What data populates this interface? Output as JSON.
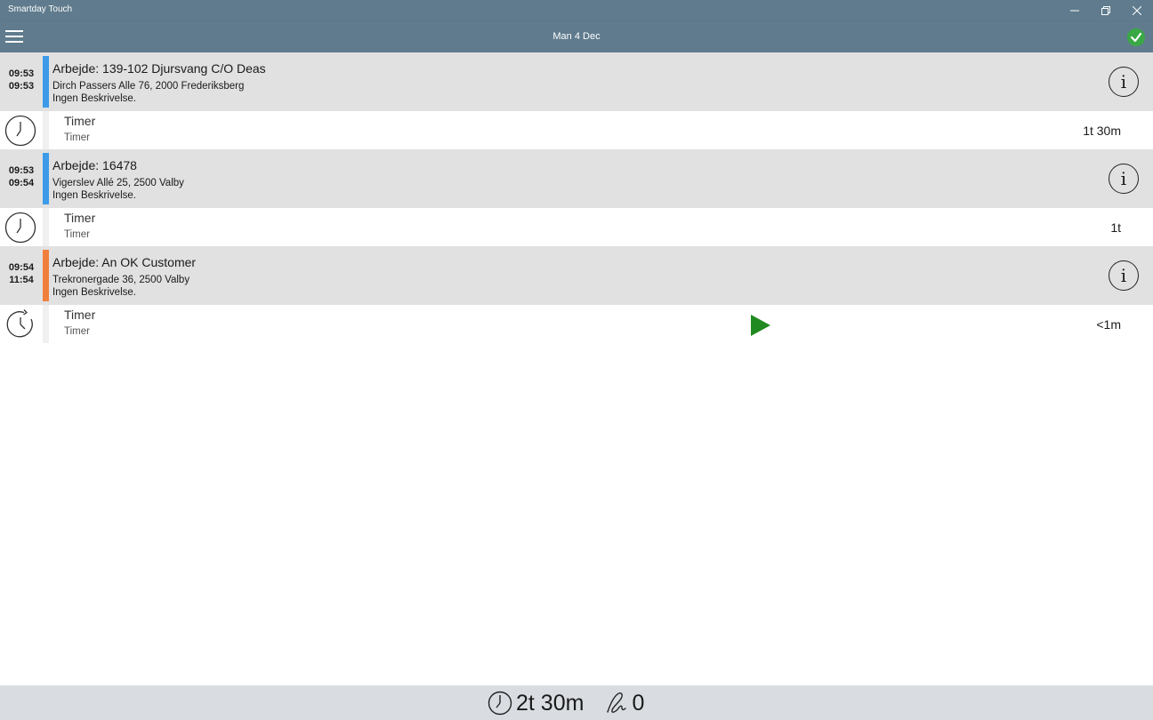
{
  "window": {
    "title": "Smartday Touch",
    "minimize_icon": "minimize-icon",
    "maximize_icon": "restore-icon",
    "close_icon": "close-icon"
  },
  "appbar": {
    "date": "Man 4 Dec",
    "menu_icon": "hamburger-icon",
    "confirm_icon": "check-icon",
    "confirm_color": "#3aa845"
  },
  "jobs": [
    {
      "start": "09:53",
      "end": "09:53",
      "title": "Arbejde: 139-102 Djursvang C/O Deas",
      "address": "Dirch Passers Alle 76, 2000 Frederiksberg",
      "description": "Ingen Beskrivelse.",
      "color": "#3d9be9",
      "timer": {
        "label": "Timer",
        "sub": "Timer",
        "duration": "1t 30m",
        "icon": "clock-icon",
        "running": false
      }
    },
    {
      "start": "09:53",
      "end": "09:54",
      "title": "Arbejde: 16478",
      "address": "Vigerslev Allé 25, 2500 Valby",
      "description": "Ingen Beskrivelse.",
      "color": "#3d9be9",
      "timer": {
        "label": "Timer",
        "sub": "Timer",
        "duration": "1t",
        "icon": "clock-icon",
        "running": false
      }
    },
    {
      "start": "09:54",
      "end": "11:54",
      "title": "Arbejde: An OK Customer",
      "address": "Trekronergade 36, 2500 Valby",
      "description": "Ingen Beskrivelse.",
      "color": "#f07f3c",
      "timer": {
        "label": "Timer",
        "sub": "Timer",
        "duration": "<1m",
        "icon": "timer-running-icon",
        "running": true
      }
    }
  ],
  "footer": {
    "total_icon": "clock-icon",
    "total": "2t 30m",
    "count_icon": "signature-icon",
    "count": "0"
  },
  "colors": {
    "header": "#5f7b8d",
    "job_bg": "#e1e1e1",
    "play": "#1f8a1f",
    "footer": "#d9dde2"
  }
}
